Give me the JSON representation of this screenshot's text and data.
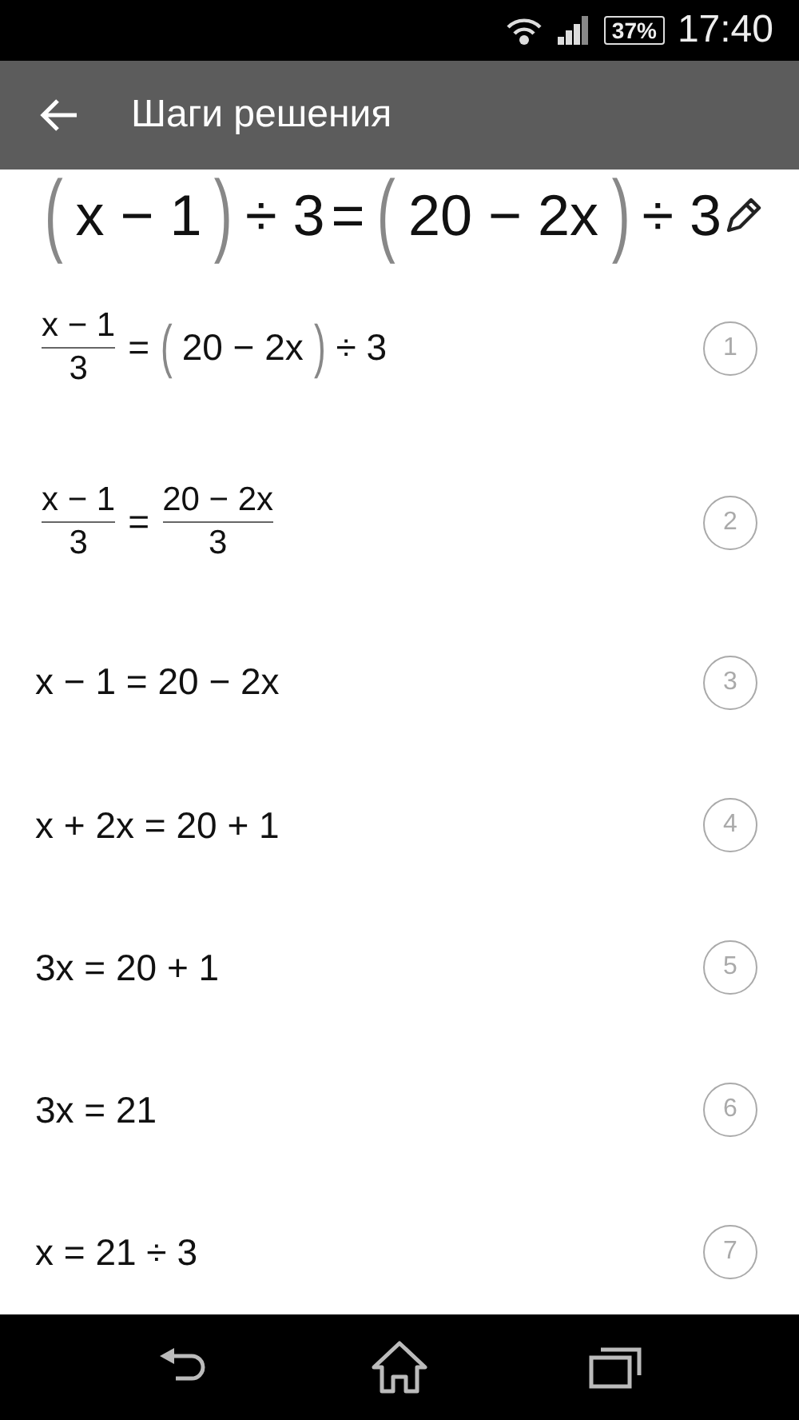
{
  "status_bar": {
    "battery": "37%",
    "time": "17:40"
  },
  "app_bar": {
    "title": "Шаги решения"
  },
  "equation": [
    {
      "kind": "paren",
      "text": "("
    },
    {
      "kind": "text",
      "text": "x − 1"
    },
    {
      "kind": "paren",
      "text": ")"
    },
    {
      "kind": "text",
      "text": "÷ 3"
    },
    {
      "kind": "text",
      "text": "="
    },
    {
      "kind": "paren",
      "text": "("
    },
    {
      "kind": "text",
      "text": "20 − 2x"
    },
    {
      "kind": "paren",
      "text": ")"
    },
    {
      "kind": "text",
      "text": "÷ 3"
    }
  ],
  "steps": [
    {
      "number": "1",
      "tokens": [
        {
          "kind": "frac",
          "num": "x − 1",
          "den": "3"
        },
        {
          "kind": "text",
          "text": "="
        },
        {
          "kind": "paren",
          "text": "("
        },
        {
          "kind": "text",
          "text": "20 − 2x"
        },
        {
          "kind": "paren",
          "text": ")"
        },
        {
          "kind": "text",
          "text": "÷ 3"
        }
      ]
    },
    {
      "number": "2",
      "tokens": [
        {
          "kind": "frac",
          "num": "x − 1",
          "den": "3"
        },
        {
          "kind": "text",
          "text": "="
        },
        {
          "kind": "frac",
          "num": "20 − 2x",
          "den": "3"
        }
      ]
    },
    {
      "number": "3",
      "tokens": [
        {
          "kind": "text",
          "text": "x − 1 = 20 − 2x"
        }
      ]
    },
    {
      "number": "4",
      "tokens": [
        {
          "kind": "text",
          "text": "x + 2x = 20 + 1"
        }
      ]
    },
    {
      "number": "5",
      "tokens": [
        {
          "kind": "text",
          "text": "3x = 20 + 1"
        }
      ]
    },
    {
      "number": "6",
      "tokens": [
        {
          "kind": "text",
          "text": "3x = 21"
        }
      ]
    },
    {
      "number": "7",
      "tokens": [
        {
          "kind": "text",
          "text": "x = 21 ÷ 3"
        }
      ]
    }
  ]
}
